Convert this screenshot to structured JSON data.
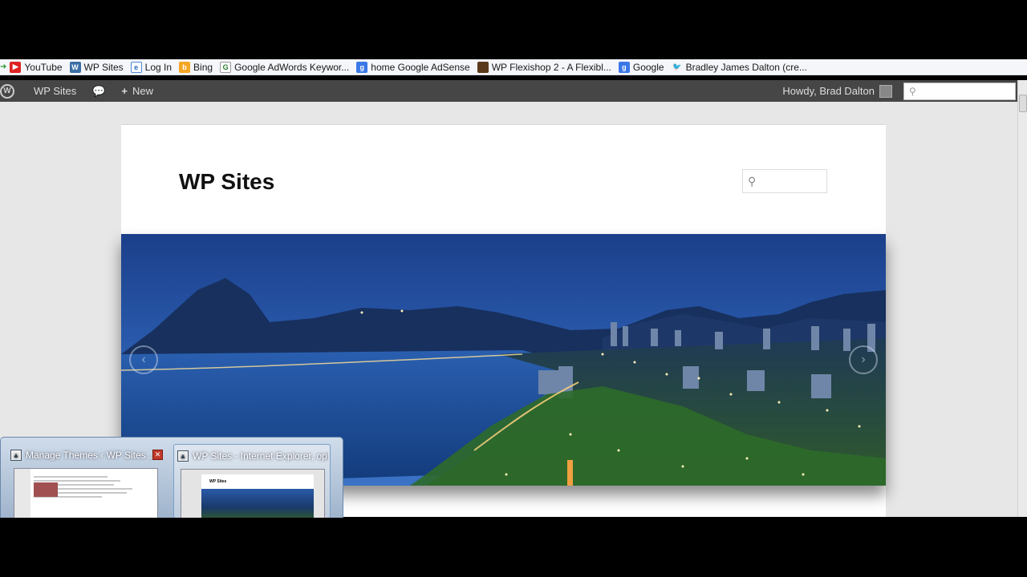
{
  "bookmarks": [
    {
      "label": "YouTube",
      "icon": "youtube-icon"
    },
    {
      "label": "WP Sites",
      "icon": "wp-sites-icon"
    },
    {
      "label": "Log In",
      "icon": "ie-icon"
    },
    {
      "label": "Bing",
      "icon": "bing-icon"
    },
    {
      "label": "Google AdWords Keywor...",
      "icon": "google-c-icon"
    },
    {
      "label": "home Google AdSense",
      "icon": "google-icon"
    },
    {
      "label": "WP Flexishop 2 - A Flexibl...",
      "icon": "flexishop-icon"
    },
    {
      "label": "Google",
      "icon": "google-icon"
    },
    {
      "label": "Bradley James Dalton (cre...",
      "icon": "twitter-icon"
    }
  ],
  "adminbar": {
    "site_name": "WP Sites",
    "new_label": "New",
    "greeting": "Howdy, Brad Dalton",
    "search_placeholder": ""
  },
  "site": {
    "title": "WP Sites",
    "search_placeholder": ""
  },
  "taskbar_popup": {
    "items": [
      {
        "title": "Manage Themes ‹ WP Sites ...",
        "active": false
      },
      {
        "title": "WP Sites - Internet Explorer, opti...",
        "active": true
      }
    ]
  },
  "colors": {
    "admin_bar": "#464646",
    "page_bg": "#e7e7e7",
    "site_bg": "#ffffff"
  }
}
